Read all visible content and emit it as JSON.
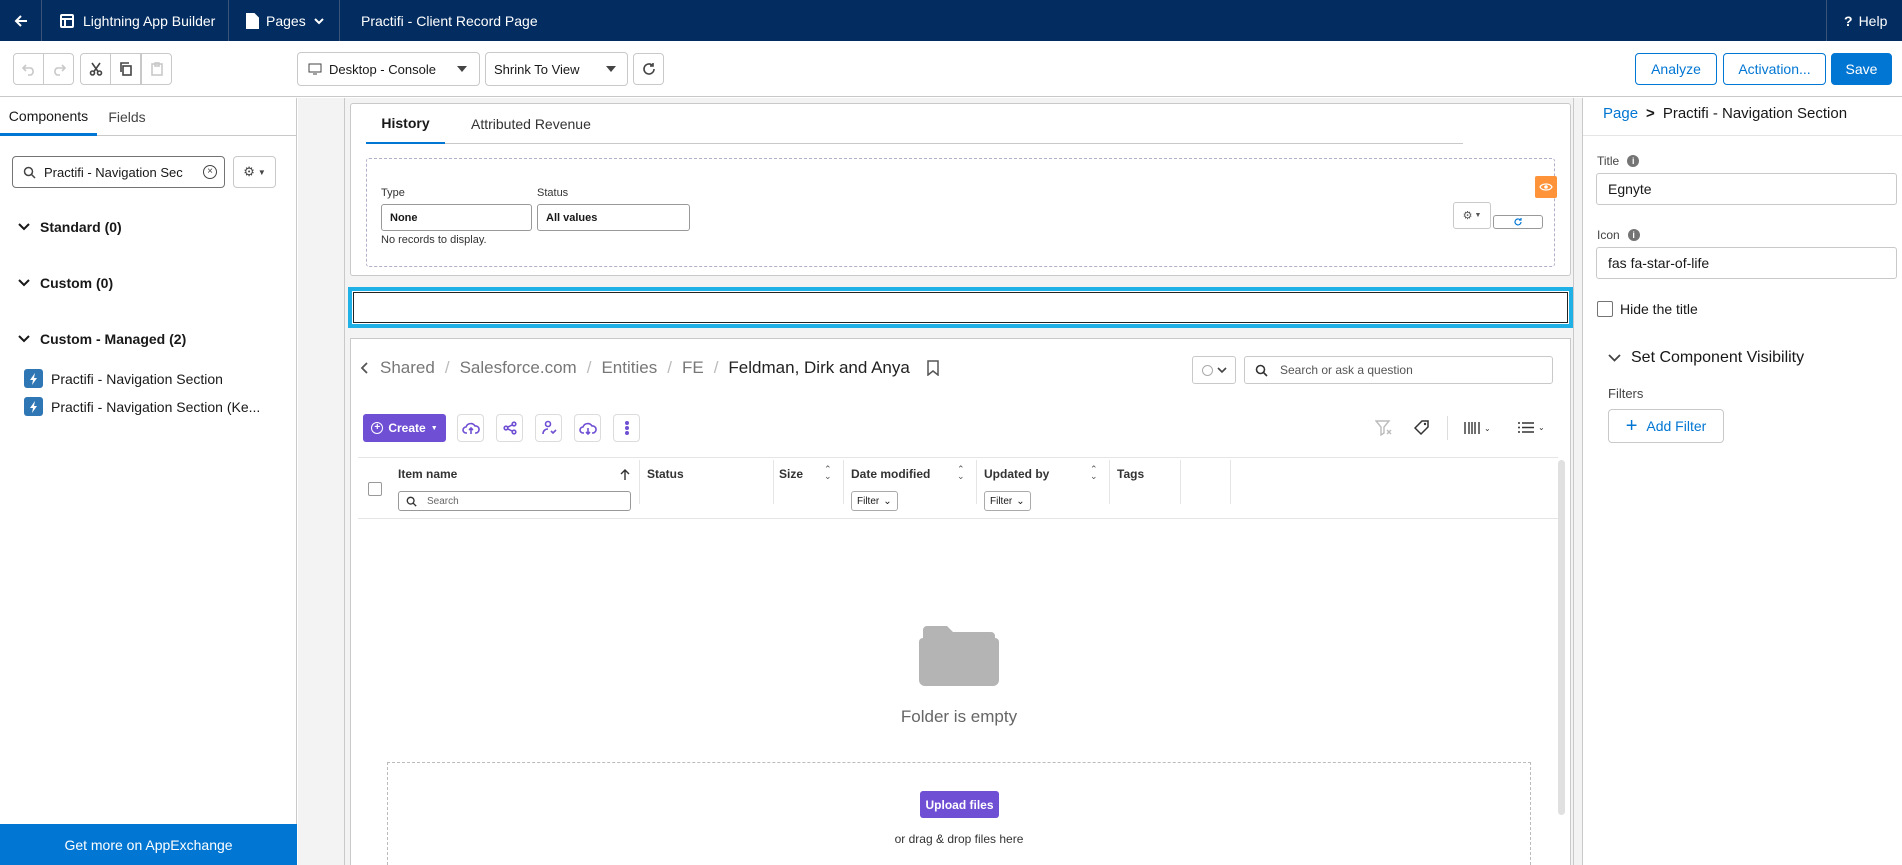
{
  "topbar": {
    "app_name": "Lightning App Builder",
    "pages_label": "Pages",
    "page_title": "Practifi - Client Record Page",
    "help_label": "Help"
  },
  "toolbar": {
    "device_select": "Desktop - Console",
    "zoom_select": "Shrink To View",
    "analyze_label": "Analyze",
    "activation_label": "Activation...",
    "save_label": "Save"
  },
  "left_panel": {
    "tabs": [
      {
        "label": "Components",
        "active": true
      },
      {
        "label": "Fields",
        "active": false
      }
    ],
    "search_value": "Practifi - Navigation Sec",
    "sections": [
      {
        "label": "Standard (0)"
      },
      {
        "label": "Custom (0)"
      },
      {
        "label": "Custom - Managed (2)"
      }
    ],
    "components": [
      {
        "label": "Practifi - Navigation Section"
      },
      {
        "label": "Practifi - Navigation Section (Ke..."
      }
    ],
    "appexchange_label": "Get more on AppExchange"
  },
  "canvas": {
    "tabs": [
      {
        "label": "History",
        "active": true
      },
      {
        "label": "Attributed Revenue",
        "active": false
      }
    ],
    "type_label": "Type",
    "type_value": "None",
    "status_label": "Status",
    "status_value": "All values",
    "no_records": "No records to display.",
    "breadcrumb": [
      {
        "label": "Shared"
      },
      {
        "label": "Salesforce.com"
      },
      {
        "label": "Entities"
      },
      {
        "label": "FE"
      },
      {
        "label": "Feldman, Dirk and Anya"
      }
    ],
    "search_placeholder": "Search or ask a question",
    "create_label": "Create",
    "columns": {
      "item_name": "Item name",
      "status": "Status",
      "size": "Size",
      "date_modified": "Date modified",
      "updated_by": "Updated by",
      "tags": "Tags"
    },
    "column_search_placeholder": "Search",
    "filter_label": "Filter",
    "empty_text": "Folder is empty",
    "upload_label": "Upload files",
    "drag_text": "or drag & drop files here"
  },
  "right_panel": {
    "breadcrumb_root": "Page",
    "breadcrumb_sep": ">",
    "breadcrumb_current": "Practifi - Navigation Section",
    "title_label": "Title",
    "title_value": "Egnyte",
    "icon_label": "Icon",
    "icon_value": "fas fa-star-of-life",
    "hide_title_label": "Hide the title",
    "visibility_label": "Set Component Visibility",
    "filters_label": "Filters",
    "add_filter_label": "Add Filter"
  },
  "colors": {
    "header": "#032d60",
    "brand_blue": "#0176d3",
    "egnyte_purple": "#6f4fd3",
    "selection_cyan": "#1fb1e6",
    "visibility_orange": "#fe9339"
  }
}
